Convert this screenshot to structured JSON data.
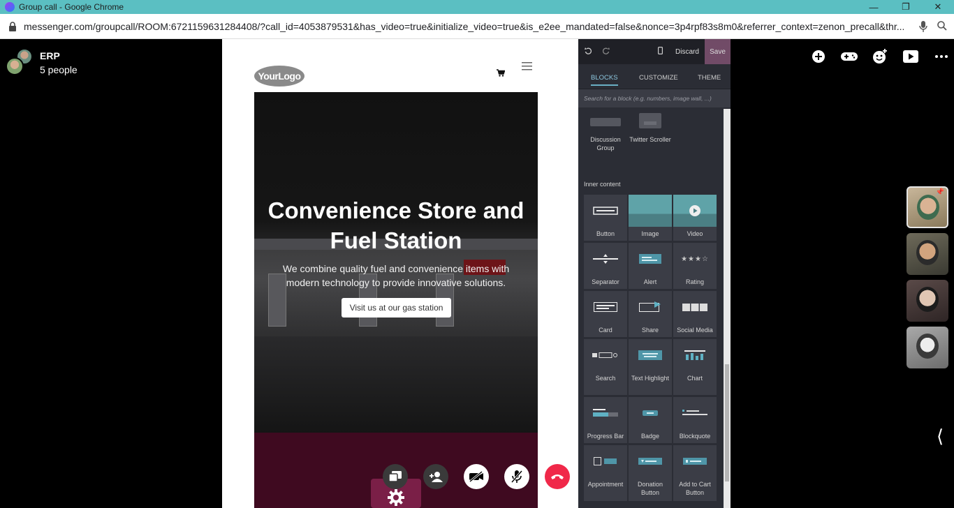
{
  "browser": {
    "window_title": "Group call - Google Chrome",
    "url": "messenger.com/groupcall/ROOM:6721159631284408/?call_id=4053879531&has_video=true&initialize_video=true&is_e2ee_mandated=false&nonce=3p4rpf83s8m0&referrer_context=zenon_precall&thr..."
  },
  "call": {
    "name": "ERP",
    "people": "5 people"
  },
  "website": {
    "logo": "YourLogo",
    "headline_line1": "Convenience Store and",
    "headline_line2": "Fuel Station",
    "subtitle": "We combine quality fuel and convenience items with modern technology to provide innovative solutions.",
    "cta": "Visit us at our gas station"
  },
  "editor": {
    "discard": "Discard",
    "save": "Save",
    "tabs": [
      "BLOCKS",
      "CUSTOMIZE",
      "THEME"
    ],
    "search_placeholder": "Search for a block (e.g. numbers, image wall, ...)",
    "top_snippets": [
      "Discussion Group",
      "Twitter Scroller"
    ],
    "section_label": "Inner content",
    "inner_content": [
      "Button",
      "Image",
      "Video",
      "Separator",
      "Alert",
      "Rating",
      "Card",
      "Share",
      "Social Media",
      "Search",
      "Text Highlight",
      "Chart",
      "Progress Bar",
      "Badge",
      "Blockquote",
      "Appointment",
      "Donation Button",
      "Add to Cart Button"
    ]
  },
  "colors": {
    "titlebar": "#5bbfc2",
    "save_button": "#714b67",
    "end_call": "#f02849",
    "accent_teal": "#6ab0c4"
  }
}
